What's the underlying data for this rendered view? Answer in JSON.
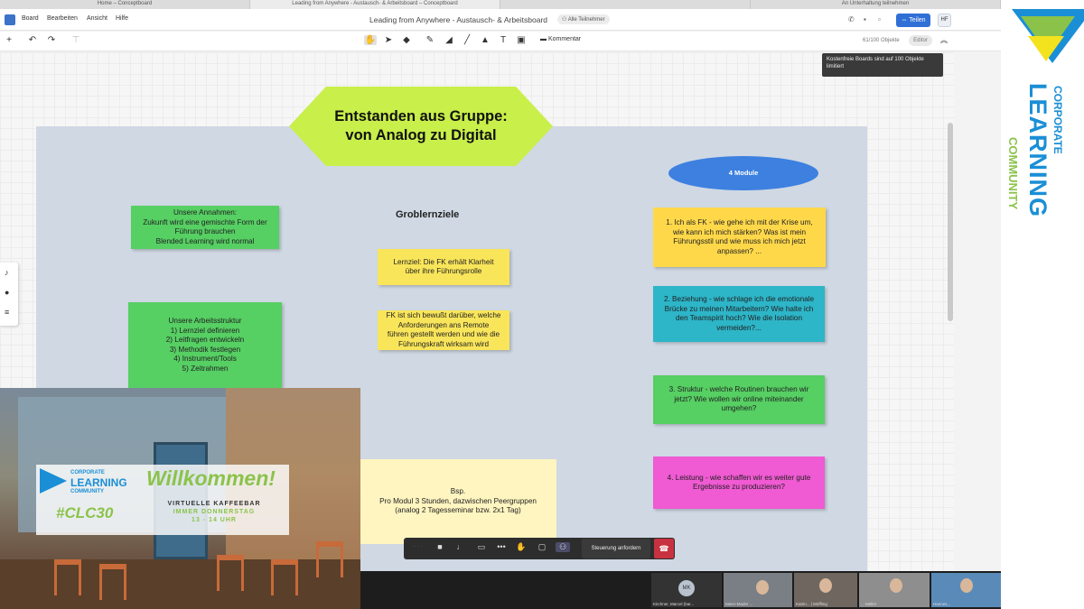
{
  "browser_tabs": [
    "Home – Conceptboard",
    "Leading from Anywhere - Austausch- & Arbeitsboard – Conceptboard",
    "",
    "An Unterhaltung teilnehmen"
  ],
  "menu": {
    "items": [
      "Board",
      "Bearbeiten",
      "Ansicht",
      "Hilfe"
    ]
  },
  "board_title": "Leading from Anywhere - Austausch- & Arbeitsboard",
  "participants_badge": "Alle Teilnehmer",
  "header": {
    "share_label": "Teilen",
    "user_initials": "HF"
  },
  "toolbar": {
    "comment_label": "Kommentar",
    "object_count": "61/100 Objekte",
    "editor_label": "Editor",
    "tooltip": "Kostenfreie Boards sind auf 100 Objekte limitiert"
  },
  "board": {
    "headline_line1": "Entstanden aus Gruppe:",
    "headline_line2": "von Analog zu Digital",
    "cloud_label": "4 Module",
    "groblernziele": "Groblernziele",
    "note_annahmen": [
      "Unsere Annahmen:",
      "Zukunft wird eine gemischte Form der",
      "Führung brauchen",
      "Blended Learning wird normal"
    ],
    "note_arbeitsstruktur": [
      "Unsere Arbeitsstruktur",
      "1) Lernziel definieren",
      "2) Leitfragen entwickeln",
      "3) Methodik festlegen",
      "4) Instrument/Tools",
      "5) Zeitrahmen"
    ],
    "note_lernziel": [
      "Lernziel: Die FK erhält Klarheit",
      "über ihre Führungsrolle"
    ],
    "note_fk": [
      "FK ist sich bewußt darüber, welche",
      "Anforderungen ans Remote",
      "führen gestellt werden und wie die",
      "Führungskraft wirksam wird"
    ],
    "note_bsp": [
      "Bsp.",
      "Pro Modul 3 Stunden, dazwischen Peergruppen",
      "(analog 2 Tagesseminar bzw. 2x1 Tag)"
    ],
    "note_m1": [
      "1. Ich als FK - wie gehe ich mit der Krise um,",
      "wie kann ich mich stärken? Was ist mein",
      "Führungsstil und wie muss ich mich jetzt",
      "anpassen? ..."
    ],
    "note_m2": [
      "2. Beziehung - wie schlage ich die emotionale",
      "Brücke zu meinen Mitarbeitern? Wie halte ich",
      "den Teamspirit hoch? Wie die Isolation",
      "vermeiden?..."
    ],
    "note_m3": [
      "3. Struktur - welche Routinen brauchen wir",
      "jetzt? Wie wollen wir online miteinander",
      "umgehen?"
    ],
    "note_m4": [
      "4. Leistung - wie schaffen wir es weiter gute",
      "Ergebnisse zu produzieren?"
    ]
  },
  "promo": {
    "logo_line1": "CORPORATE",
    "logo_line2": "LEARNING",
    "logo_line3": "COMMUNITY",
    "welcome": "Willkommen!",
    "hashtag": "#CLC30",
    "line1": "VIRTUELLE KAFFEEBAR",
    "line2": "IMMER DONNERSTAG",
    "line3": "13 - 14 UHR"
  },
  "callbar": {
    "control_request": "Steuerung anfordern"
  },
  "participants": [
    {
      "initials": "MK",
      "name": "Kirchner, Marcel (bar..."
    },
    {
      "name": "Meier-Mader ..."
    },
    {
      "name": "Katrin... | Möffling"
    },
    {
      "name": "... Müller"
    },
    {
      "name": "Hannes..."
    }
  ],
  "brand": {
    "line1": "CORPORATE",
    "line2": "LEARNING",
    "line3": "COMMUNITY"
  },
  "colors": {
    "accent_blue": "#2f6fd6",
    "brand_blue": "#1a8fd6",
    "brand_green": "#8bc34a",
    "hangup_red": "#c83240"
  }
}
